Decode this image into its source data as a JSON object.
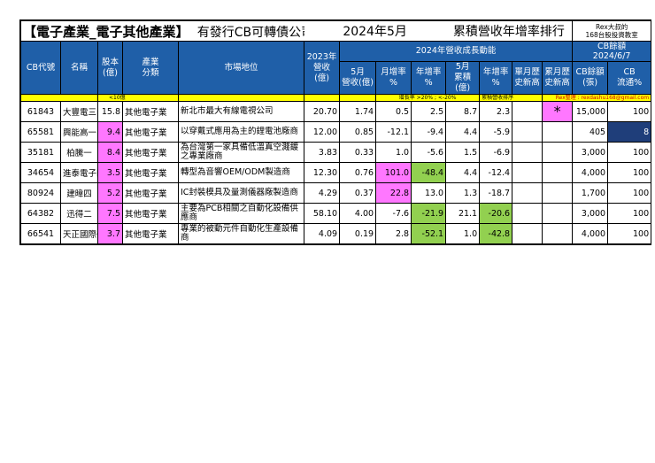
{
  "title": {
    "category": "【電子產業_電子其他產業】",
    "subtitle": "有發行CB可轉債公司",
    "period": "2024年5月",
    "ranking": "累積營收年增率排行",
    "rex_line1": "Rex大叔的",
    "rex_line2": "168台股投資教室",
    "cb_balance_label": "CB餘額",
    "date": "2024/6/7"
  },
  "headers": {
    "code": "CB代號",
    "name": "名稱",
    "capital": "股本\n(億)",
    "industry": "產業\n分類",
    "market": "市場地位",
    "rev2023": "2023年\n營收(億)",
    "growth_group": "2024年營收成長動能",
    "may_rev": "5月\n營收(億)",
    "mom": "月增率\n%",
    "yoy": "年增率\n%",
    "may_cum": "5月\n累積(億)",
    "cum_yoy": "年增率\n%",
    "month_high": "單月歷\n史新高",
    "cum_high": "累月歷\n史新高",
    "cb_amount": "CB餘額\n(張)",
    "cb_float": "CB\n流通%"
  },
  "notes": {
    "capital_note": "<10億",
    "yoy_note": "增長率 >20% ; <-20%",
    "cum_note": "累積營收排序",
    "rex_credit": "Rex整理 : rexdashu168@gmail.com"
  },
  "rows": [
    {
      "code": "61843",
      "name": "大豐電三",
      "capital": "15.8",
      "industry": "其他電子業",
      "market": "新北市最大有線電視公司",
      "rev2023": "20.70",
      "may_rev": "1.74",
      "mom": "0.5",
      "yoy": "2.5",
      "may_cum": "8.7",
      "cum_yoy": "2.3",
      "month_high": "",
      "cum_high": "*",
      "cb_amount": "15,000",
      "cb_float": "100",
      "hl": {
        "cum_high": "pink"
      }
    },
    {
      "code": "65581",
      "name": "興能高一",
      "capital": "9.4",
      "industry": "其他電子業",
      "market": "以穿戴式應用為主的鋰電池廠商",
      "rev2023": "12.00",
      "may_rev": "0.85",
      "mom": "-12.1",
      "yoy": "-9.4",
      "may_cum": "4.4",
      "cum_yoy": "-5.9",
      "month_high": "",
      "cum_high": "",
      "cb_amount": "405",
      "cb_float": "8",
      "hl": {
        "capital": "pink",
        "cb_float": "navy"
      }
    },
    {
      "code": "35181",
      "name": "柏騰一",
      "capital": "8.4",
      "industry": "其他電子業",
      "market": "為台灣第一家具備低溫真空濺鍍之專業廠商",
      "rev2023": "3.83",
      "may_rev": "0.33",
      "mom": "1.0",
      "yoy": "-5.6",
      "may_cum": "1.5",
      "cum_yoy": "-6.9",
      "month_high": "",
      "cum_high": "",
      "cb_amount": "3,000",
      "cb_float": "100",
      "hl": {
        "capital": "pink"
      }
    },
    {
      "code": "34654",
      "name": "進泰電子四",
      "capital": "3.5",
      "industry": "其他電子業",
      "market": "轉型為音響OEM/ODM製造商",
      "rev2023": "12.30",
      "may_rev": "0.76",
      "mom": "101.0",
      "yoy": "-48.4",
      "may_cum": "4.4",
      "cum_yoy": "-12.4",
      "month_high": "",
      "cum_high": "",
      "cb_amount": "4,000",
      "cb_float": "100",
      "hl": {
        "capital": "pink",
        "mom": "pink",
        "yoy": "green"
      }
    },
    {
      "code": "80924",
      "name": "建暐四",
      "capital": "5.2",
      "industry": "其他電子業",
      "market": "IC封裝模具及量測儀器廠製造商",
      "rev2023": "4.29",
      "may_rev": "0.37",
      "mom": "22.8",
      "yoy": "13.0",
      "may_cum": "1.3",
      "cum_yoy": "-18.7",
      "month_high": "",
      "cum_high": "",
      "cb_amount": "1,700",
      "cb_float": "100",
      "hl": {
        "capital": "pink",
        "mom": "pink"
      }
    },
    {
      "code": "64382",
      "name": "迅得二",
      "capital": "7.5",
      "industry": "其他電子業",
      "market": "主要為PCB相關之自動化設備供應商",
      "rev2023": "58.10",
      "may_rev": "4.00",
      "mom": "-7.6",
      "yoy": "-21.9",
      "may_cum": "21.1",
      "cum_yoy": "-20.6",
      "month_high": "",
      "cum_high": "",
      "cb_amount": "3,000",
      "cb_float": "100",
      "hl": {
        "capital": "pink",
        "yoy": "green",
        "cum_yoy": "green"
      }
    },
    {
      "code": "66541",
      "name": "天正國際一",
      "capital": "3.7",
      "industry": "其他電子業",
      "market": "專業的被動元件自動化生產設備商",
      "rev2023": "4.09",
      "may_rev": "0.19",
      "mom": "2.8",
      "yoy": "-52.1",
      "may_cum": "1.0",
      "cum_yoy": "-42.8",
      "month_high": "",
      "cum_high": "",
      "cb_amount": "4,000",
      "cb_float": "100",
      "hl": {
        "capital": "pink",
        "yoy": "green",
        "cum_yoy": "green"
      }
    }
  ]
}
